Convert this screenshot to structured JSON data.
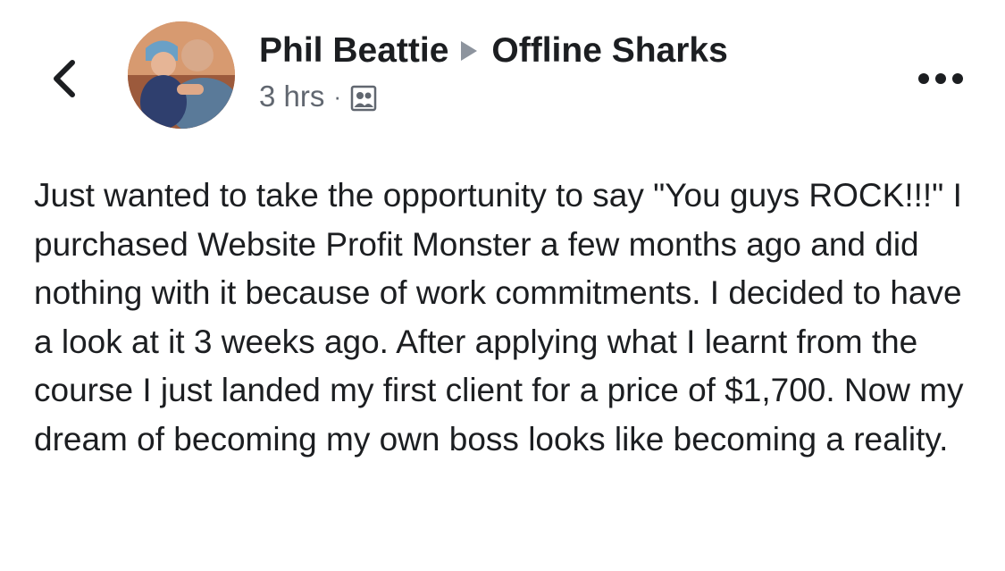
{
  "header": {
    "author": "Phil Beattie",
    "group": "Offline Sharks",
    "time": "3 hrs",
    "separator": "·",
    "icons": {
      "back": "chevron-left-icon",
      "arrow": "triangle-right-icon",
      "audience": "group-audience-icon",
      "more": "more-horizontal-icon"
    }
  },
  "post": {
    "text": "Just wanted to take the opportunity to say \"You guys ROCK!!!\" I purchased Website Profit Monster a few months ago and did nothing with it because of work commitments. I decided to have a look at it 3 weeks ago. After applying what I learnt from the course I just landed my first client for a price of $1,700. Now my dream of becoming my own boss looks like becoming a reality."
  },
  "colors": {
    "text": "#1c1e21",
    "secondary": "#616770",
    "arrow": "#8d949e"
  }
}
